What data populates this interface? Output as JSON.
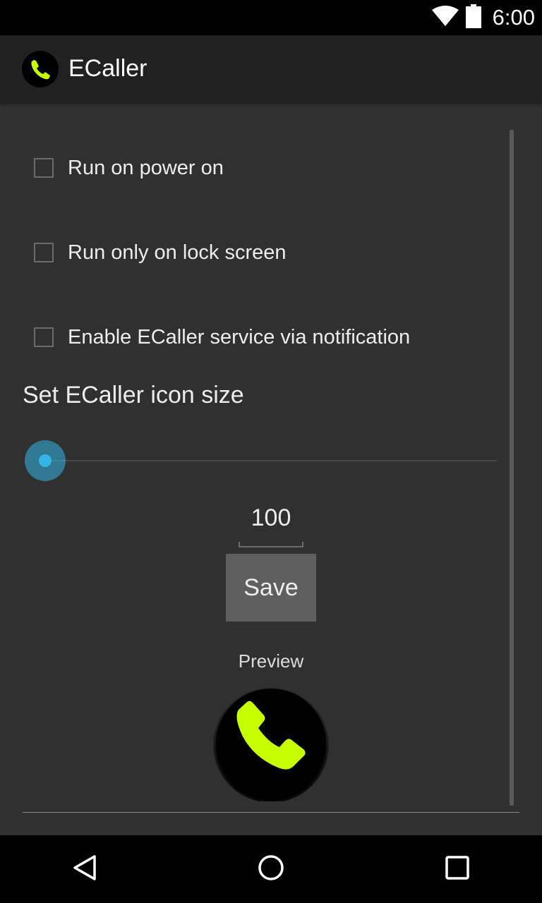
{
  "status_bar": {
    "time": "6:00",
    "icons": [
      "wifi-icon",
      "battery-icon"
    ]
  },
  "app_bar": {
    "title": "ECaller",
    "icon": "phone-icon"
  },
  "settings": {
    "options": [
      {
        "label": "Run on power on",
        "checked": false
      },
      {
        "label": "Run only on lock screen",
        "checked": false
      },
      {
        "label": "Enable ECaller service via notification",
        "checked": false
      }
    ],
    "icon_size_title": "Set ECaller icon size",
    "slider_level": 0,
    "size_value": "100",
    "save_label": "Save",
    "preview_label": "Preview"
  },
  "nav_bar": {
    "buttons": [
      "back-icon",
      "home-icon",
      "recents-icon"
    ]
  },
  "colors": {
    "background": "#303030",
    "app_bar": "#212121",
    "accent": "#33b5e5",
    "phone_green": "#c6ff00",
    "button": "#5f5f5f"
  }
}
